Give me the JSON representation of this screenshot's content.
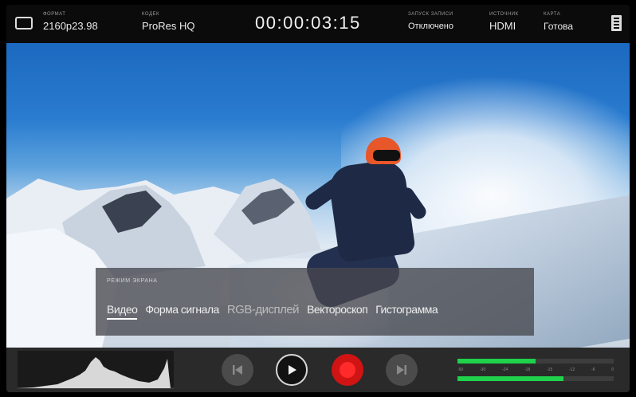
{
  "topbar": {
    "format": {
      "label": "ФОРМАТ",
      "value": "2160p23.98"
    },
    "codec": {
      "label": "КОДЕК",
      "value": "ProRes HQ"
    },
    "timecode": "00:00:03:15",
    "record_trigger": {
      "label": "ЗАПУСК ЗАПИСИ",
      "value": "Отключено"
    },
    "source": {
      "label": "ИСТОЧНИК",
      "value": "HDMI"
    },
    "card": {
      "label": "КАРТА",
      "value": "Готова"
    }
  },
  "display_mode": {
    "title": "РЕЖИМ ЭКРАНА",
    "tabs": [
      {
        "label": "Видео",
        "active": true
      },
      {
        "label": "Форма сигнала"
      },
      {
        "label": "RGB-дисплей"
      },
      {
        "label": "Вектороскоп"
      },
      {
        "label": "Гистограмма"
      }
    ]
  },
  "transport": {
    "buttons": [
      "skip-back",
      "play",
      "record",
      "skip-forward"
    ],
    "record_color": "#d01414"
  },
  "audio_meters": {
    "channel_1_level": 0.5,
    "channel_2_level": 0.68,
    "scale": [
      "-50",
      "-30",
      "-24",
      "-18",
      "-15",
      "-12",
      "-8",
      "0"
    ],
    "meter_color": "#1fd14b"
  }
}
